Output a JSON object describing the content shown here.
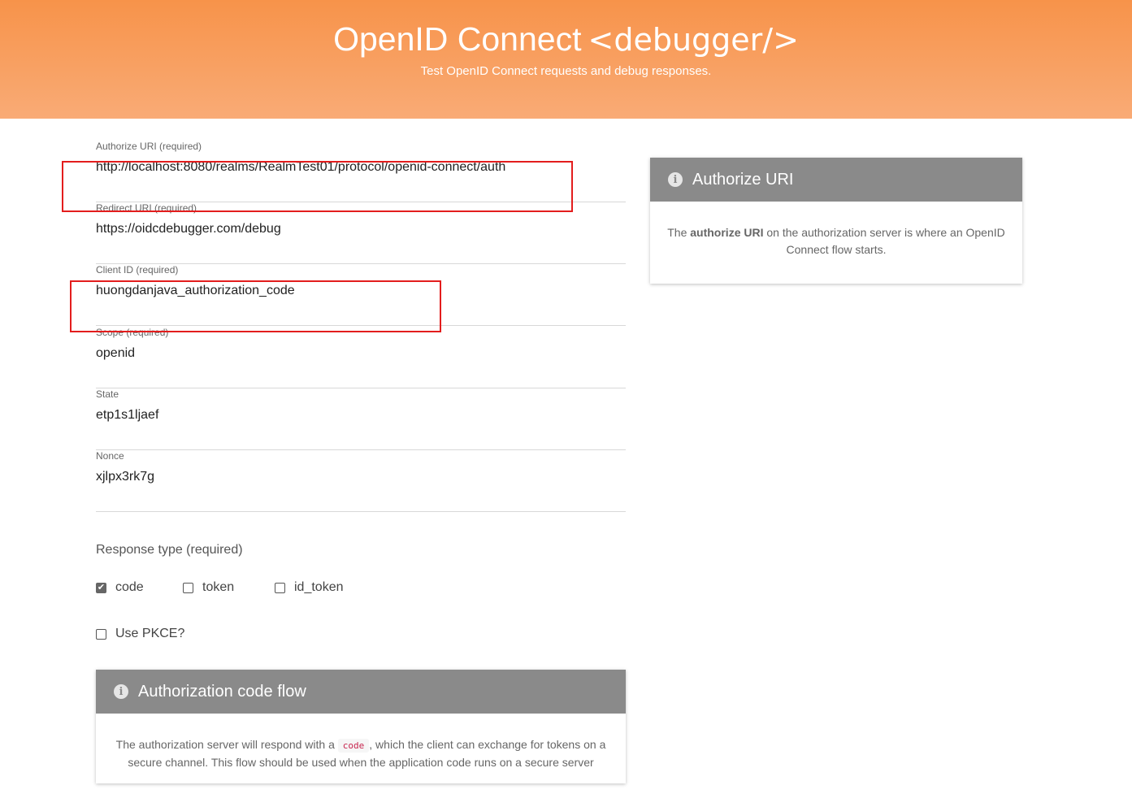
{
  "header": {
    "brand": "OpenID Connect",
    "tag": "<debugger/>",
    "subtitle": "Test OpenID Connect requests and debug responses."
  },
  "fields": {
    "authorize_uri": {
      "label": "Authorize URI (required)",
      "value": "http://localhost:8080/realms/RealmTest01/protocol/openid-connect/auth"
    },
    "redirect_uri": {
      "label": "Redirect URI (required)",
      "value": "https://oidcdebugger.com/debug"
    },
    "client_id": {
      "label": "Client ID (required)",
      "value": "huongdanjava_authorization_code"
    },
    "scope": {
      "label": "Scope (required)",
      "value": "openid"
    },
    "state": {
      "label": "State",
      "value": "etp1s1ljaef"
    },
    "nonce": {
      "label": "Nonce",
      "value": "xjlpx3rk7g"
    }
  },
  "response_type": {
    "label": "Response type (required)",
    "options": [
      {
        "label": "code",
        "checked": true
      },
      {
        "label": "token",
        "checked": false
      },
      {
        "label": "id_token",
        "checked": false
      }
    ]
  },
  "pkce": {
    "label": "Use PKCE?",
    "checked": false
  },
  "info_card": {
    "title": "Authorize URI",
    "text_prefix": "The ",
    "text_bold": "authorize URI",
    "text_suffix": " on the authorization server is where an OpenID Connect flow starts."
  },
  "flow_card": {
    "title": "Authorization code flow",
    "text_prefix": "The authorization server will respond with a",
    "code": "code",
    "text_suffix": ", which the client can exchange for tokens on a secure channel. This flow should be used when the application code runs on a secure server"
  },
  "colors": {
    "header_top": "#f7934a",
    "header_bottom": "#f9ab76",
    "card_header": "#8a8a8a",
    "highlight_box": "#e31d1d"
  }
}
